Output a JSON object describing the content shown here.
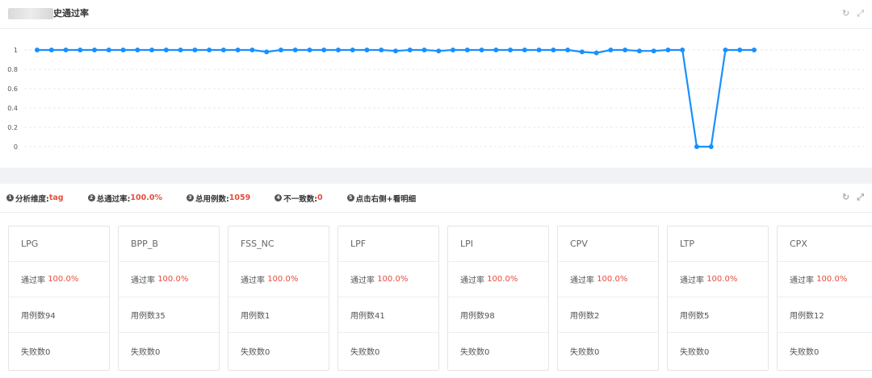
{
  "chart_panel": {
    "title": "史通过率",
    "refresh_icon": "refresh-icon",
    "expand_icon": "expand-icon"
  },
  "chart_data": {
    "type": "line",
    "ylim": [
      0,
      1
    ],
    "y_ticks": [
      "1",
      "0.8",
      "0.6",
      "0.4",
      "0.2",
      "0"
    ],
    "grid": true,
    "color": "#1890ff",
    "series": [
      {
        "values": [
          1,
          1,
          1,
          1,
          1,
          1,
          1,
          1,
          1,
          1,
          1,
          1,
          1,
          1,
          1,
          1,
          0.98,
          1,
          1,
          1,
          1,
          1,
          1,
          1,
          1,
          0.99,
          1,
          1,
          0.99,
          1,
          1,
          1,
          1,
          1,
          1,
          1,
          1,
          1,
          0.98,
          0.97,
          1,
          1,
          0.99,
          0.99,
          1,
          1,
          0,
          0,
          1,
          1,
          1
        ]
      }
    ]
  },
  "summary_panel": {
    "stats": [
      {
        "num": "1",
        "label": "分析维度:",
        "value": "tag"
      },
      {
        "num": "2",
        "label": "总通过率:",
        "value": "100.0%"
      },
      {
        "num": "3",
        "label": "总用例数:",
        "value": "1059"
      },
      {
        "num": "4",
        "label": "不一致数:",
        "value": "0"
      },
      {
        "num": "5",
        "label": "点击右侧+看明细",
        "value": ""
      }
    ],
    "cards": [
      {
        "name": "LPG",
        "pass_label": "通过率 ",
        "pass_value": "100.0%",
        "cases": "用例数94",
        "fails": "失败数0"
      },
      {
        "name": "BPP_B",
        "pass_label": "通过率 ",
        "pass_value": "100.0%",
        "cases": "用例数35",
        "fails": "失败数0"
      },
      {
        "name": "FSS_NC",
        "pass_label": "通过率 ",
        "pass_value": "100.0%",
        "cases": "用例数1",
        "fails": "失败数0"
      },
      {
        "name": "LPF",
        "pass_label": "通过率 ",
        "pass_value": "100.0%",
        "cases": "用例数41",
        "fails": "失败数0"
      },
      {
        "name": "LPI",
        "pass_label": "通过率 ",
        "pass_value": "100.0%",
        "cases": "用例数98",
        "fails": "失败数0"
      },
      {
        "name": "CPV",
        "pass_label": "通过率 ",
        "pass_value": "100.0%",
        "cases": "用例数2",
        "fails": "失败数0"
      },
      {
        "name": "LTP",
        "pass_label": "通过率 ",
        "pass_value": "100.0%",
        "cases": "用例数5",
        "fails": "失败数0"
      },
      {
        "name": "CPX",
        "pass_label": "通过率 ",
        "pass_value": "100.0%",
        "cases": "用例数12",
        "fails": "失败数0"
      }
    ]
  }
}
